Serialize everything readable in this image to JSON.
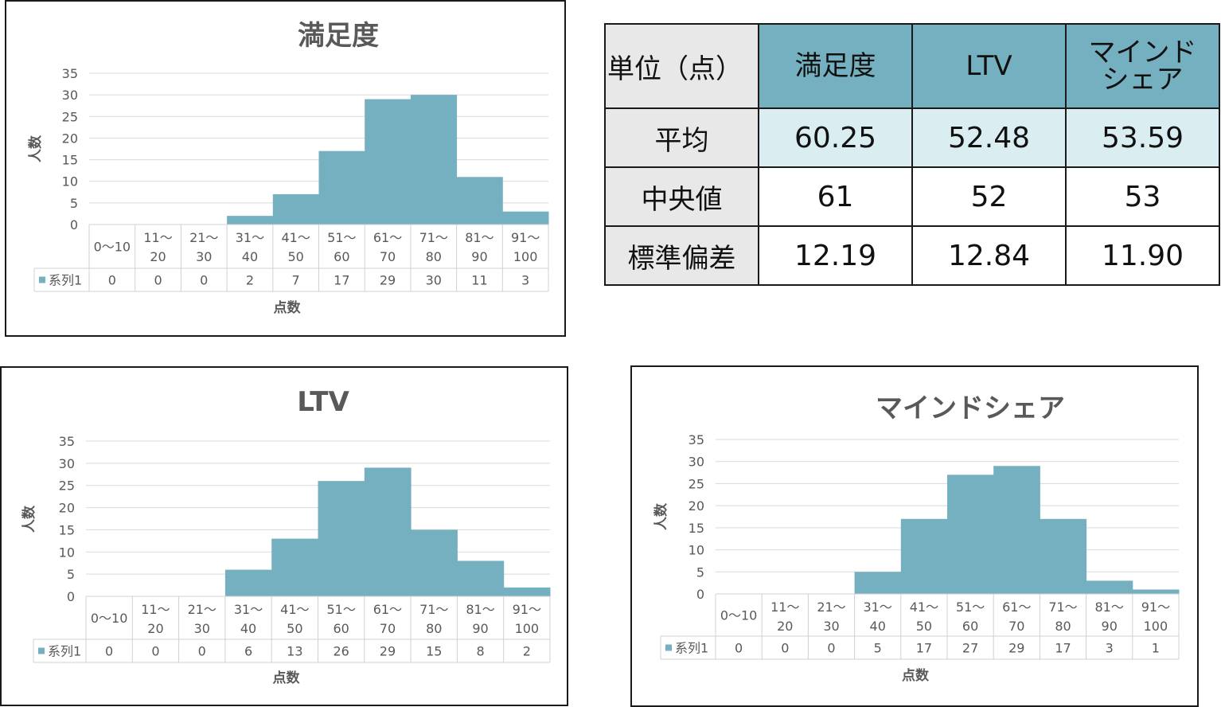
{
  "table": {
    "corner": "単位（点）",
    "columns": [
      {
        "lines": [
          "満足度"
        ]
      },
      {
        "lines": [
          "LTV"
        ]
      },
      {
        "lines": [
          "マインド",
          "シェア"
        ]
      }
    ],
    "rows": [
      {
        "label": "平均",
        "values": [
          "60.25",
          "52.48",
          "53.59"
        ]
      },
      {
        "label": "中央値",
        "values": [
          "61",
          "52",
          "53"
        ]
      },
      {
        "label": "標準偏差",
        "values": [
          "12.19",
          "12.84",
          "11.90"
        ]
      }
    ]
  },
  "chart_data": [
    {
      "type": "bar",
      "title": "満足度",
      "xlabel": "点数",
      "ylabel": "人数",
      "categories": [
        [
          "0～10"
        ],
        [
          "11～",
          "20"
        ],
        [
          "21～",
          "30"
        ],
        [
          "31～",
          "40"
        ],
        [
          "41～",
          "50"
        ],
        [
          "51～",
          "60"
        ],
        [
          "61～",
          "70"
        ],
        [
          "71～",
          "80"
        ],
        [
          "81～",
          "90"
        ],
        [
          "91～",
          "100"
        ]
      ],
      "series": [
        {
          "name": "系列1",
          "values": [
            0,
            0,
            0,
            2,
            7,
            17,
            29,
            30,
            11,
            3
          ]
        }
      ],
      "ylim": [
        0,
        35
      ],
      "yticks": [
        "0",
        "5",
        "10",
        "15",
        "20",
        "25",
        "30",
        "35"
      ],
      "grid": true,
      "data_table": true,
      "color": "#74b0bf"
    },
    {
      "type": "bar",
      "title": "LTV",
      "xlabel": "点数",
      "ylabel": "人数",
      "categories": [
        [
          "0～10"
        ],
        [
          "11～",
          "20"
        ],
        [
          "21～",
          "30"
        ],
        [
          "31～",
          "40"
        ],
        [
          "41～",
          "50"
        ],
        [
          "51～",
          "60"
        ],
        [
          "61～",
          "70"
        ],
        [
          "71～",
          "80"
        ],
        [
          "81～",
          "90"
        ],
        [
          "91～",
          "100"
        ]
      ],
      "series": [
        {
          "name": "系列1",
          "values": [
            0,
            0,
            0,
            6,
            13,
            26,
            29,
            15,
            8,
            2
          ]
        }
      ],
      "ylim": [
        0,
        35
      ],
      "yticks": [
        "0",
        "5",
        "10",
        "15",
        "20",
        "25",
        "30",
        "35"
      ],
      "grid": true,
      "data_table": true,
      "color": "#74b0bf"
    },
    {
      "type": "bar",
      "title": "マインドシェア",
      "xlabel": "点数",
      "ylabel": "人数",
      "categories": [
        [
          "0～10"
        ],
        [
          "11～",
          "20"
        ],
        [
          "21～",
          "30"
        ],
        [
          "31～",
          "40"
        ],
        [
          "41～",
          "50"
        ],
        [
          "51～",
          "60"
        ],
        [
          "61～",
          "70"
        ],
        [
          "71～",
          "80"
        ],
        [
          "81～",
          "90"
        ],
        [
          "91～",
          "100"
        ]
      ],
      "series": [
        {
          "name": "系列1",
          "values": [
            0,
            0,
            0,
            5,
            17,
            27,
            29,
            17,
            3,
            1
          ]
        }
      ],
      "ylim": [
        0,
        35
      ],
      "yticks": [
        "0",
        "5",
        "10",
        "15",
        "20",
        "25",
        "30",
        "35"
      ],
      "grid": true,
      "data_table": true,
      "color": "#74b0bf"
    }
  ]
}
